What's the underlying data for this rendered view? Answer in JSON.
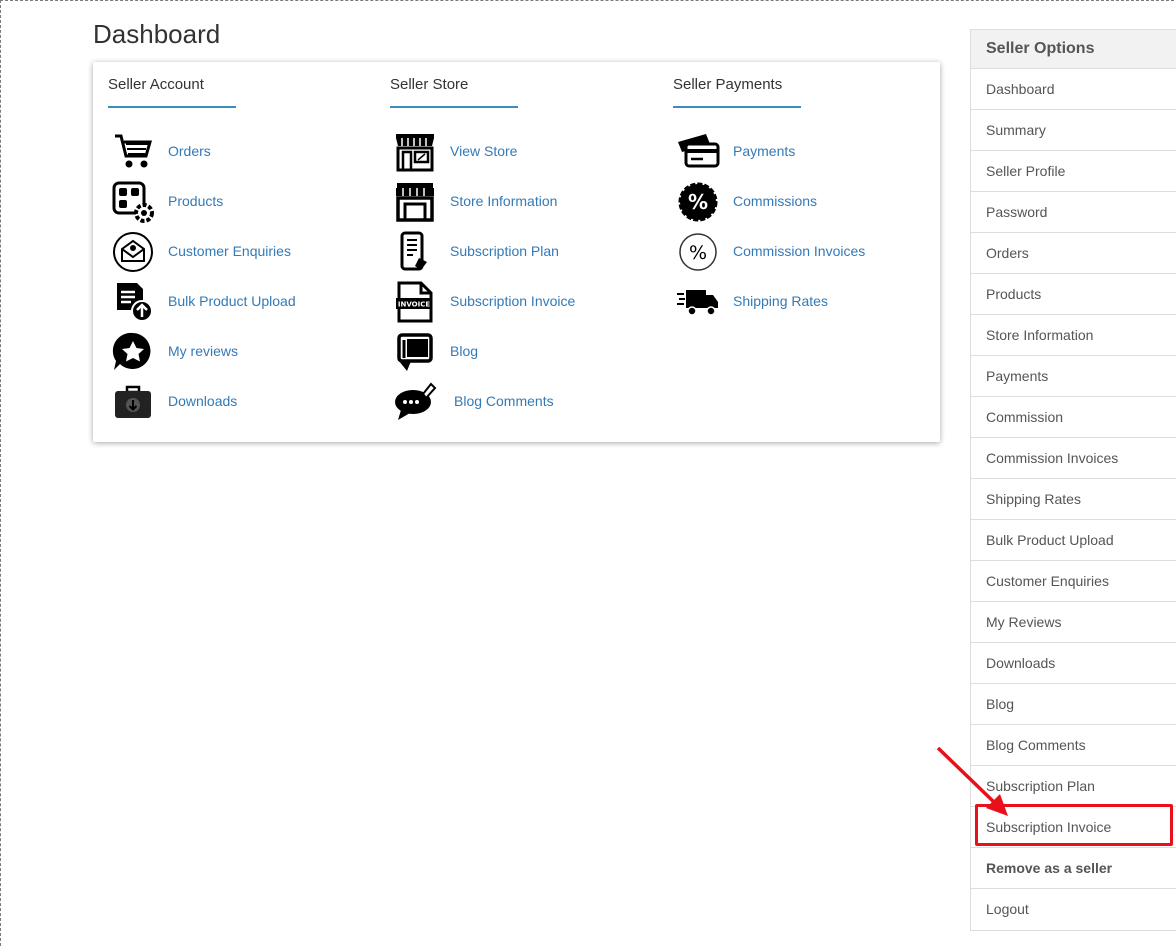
{
  "page": {
    "title": "Dashboard"
  },
  "dashboard": {
    "columns": [
      {
        "title": "Seller Account",
        "items": [
          {
            "label": "Orders",
            "icon": "cart-icon"
          },
          {
            "label": "Products",
            "icon": "products-gear-icon"
          },
          {
            "label": "Customer Enquiries",
            "icon": "envelope-icon"
          },
          {
            "label": "Bulk Product Upload",
            "icon": "upload-document-icon"
          },
          {
            "label": "My reviews",
            "icon": "star-badge-icon"
          },
          {
            "label": "Downloads",
            "icon": "download-box-icon"
          }
        ]
      },
      {
        "title": "Seller Store",
        "items": [
          {
            "label": "View Store",
            "icon": "storefront-icon"
          },
          {
            "label": "Store Information",
            "icon": "store-info-icon"
          },
          {
            "label": "Subscription Plan",
            "icon": "mobile-plan-icon"
          },
          {
            "label": "Subscription Invoice",
            "icon": "invoice-icon"
          },
          {
            "label": "Blog",
            "icon": "blog-book-icon"
          },
          {
            "label": "Blog Comments",
            "icon": "comment-bubble-icon"
          }
        ]
      },
      {
        "title": "Seller Payments",
        "items": [
          {
            "label": "Payments",
            "icon": "card-payment-icon"
          },
          {
            "label": "Commissions",
            "icon": "percent-badge-icon"
          },
          {
            "label": "Commission Invoices",
            "icon": "percent-circle-icon"
          },
          {
            "label": "Shipping Rates",
            "icon": "delivery-truck-icon"
          }
        ]
      }
    ]
  },
  "sidebar": {
    "header": "Seller Options",
    "items": [
      {
        "label": "Dashboard"
      },
      {
        "label": "Summary"
      },
      {
        "label": "Seller Profile"
      },
      {
        "label": "Password"
      },
      {
        "label": "Orders"
      },
      {
        "label": "Products"
      },
      {
        "label": "Store Information"
      },
      {
        "label": "Payments"
      },
      {
        "label": "Commission"
      },
      {
        "label": "Commission Invoices"
      },
      {
        "label": "Shipping Rates"
      },
      {
        "label": "Bulk Product Upload"
      },
      {
        "label": "Customer Enquiries"
      },
      {
        "label": "My Reviews"
      },
      {
        "label": "Downloads"
      },
      {
        "label": "Blog"
      },
      {
        "label": "Blog Comments"
      },
      {
        "label": "Subscription Plan"
      },
      {
        "label": "Subscription Invoice"
      },
      {
        "label": "Remove as a seller"
      },
      {
        "label": "Logout"
      }
    ]
  },
  "colors": {
    "link": "#337ab7",
    "accent": "#3c8dbc",
    "annotation": "#e8101a"
  }
}
